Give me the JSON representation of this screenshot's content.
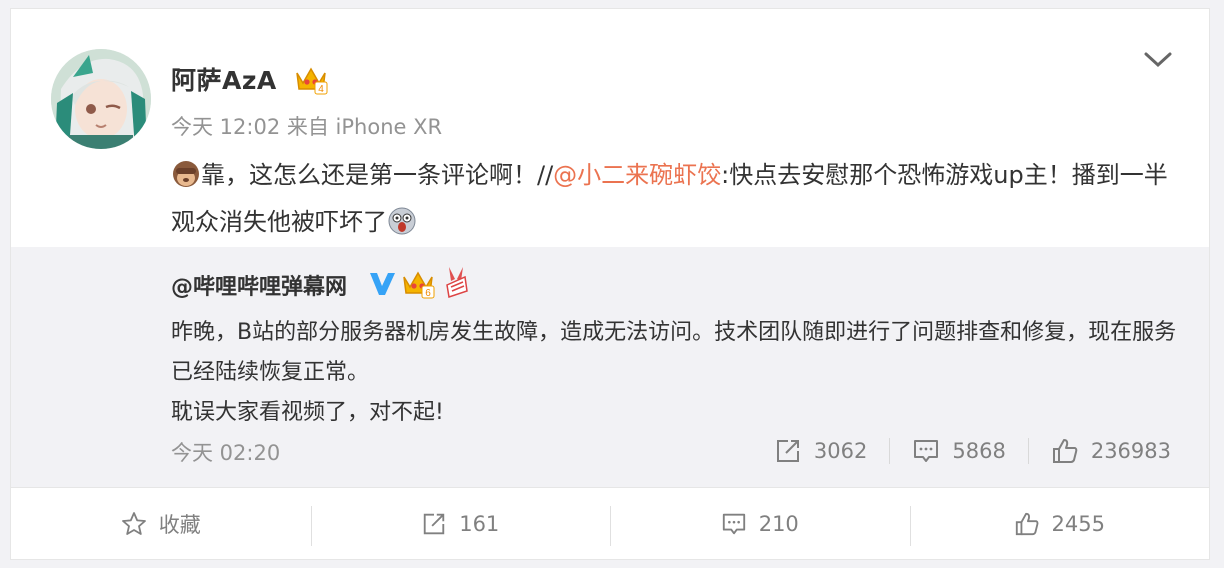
{
  "post": {
    "author": "阿萨AzA",
    "meta": "今天 12:02 来自 iPhone XR",
    "text_before": "靠，这怎么还是第一条评论啊！//",
    "mention": "@小二来碗虾饺",
    "text_after": ":快点去安慰那个恐怖游戏up主！播到一半观众消失他被吓坏了",
    "emoji_start": "see-no-evil-monkey-emoji",
    "emoji_end": "scared-doge-emoji"
  },
  "repost": {
    "author": "@哔哩哔哩弹幕网",
    "paragraphs": [
      "昨晚，B站的部分服务器机房发生故障，造成无法访问。技术团队随即进行了问题排查和修复，现在服务已经陆续恢复正常。",
      "耽误大家看视频了，对不起!"
    ],
    "time": "今天 02:20",
    "reposts": "3062",
    "comments": "5868",
    "likes": "236983"
  },
  "footer": {
    "favorite_label": "收藏",
    "reposts": "161",
    "comments": "210",
    "likes": "2455"
  },
  "colors": {
    "mention": "#eb7350",
    "verified": "#36a3f6",
    "crown": "#f5b400",
    "background": "#f2f2f5"
  }
}
